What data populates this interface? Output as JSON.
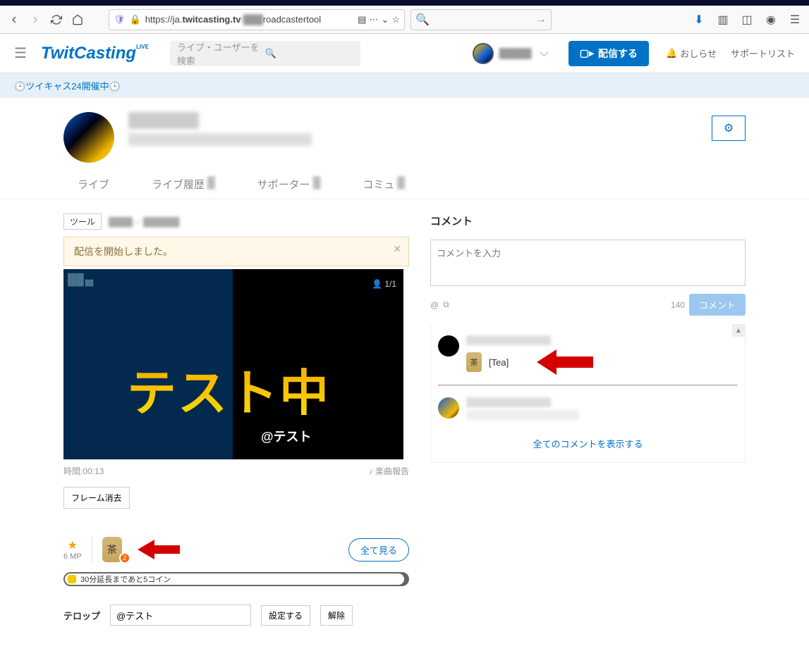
{
  "browser": {
    "url_prefix": "https://ja.",
    "url_domain": "twitcasting.tv",
    "url_suffix": "roadcastertool",
    "url_hidden": "/███"
  },
  "header": {
    "logo": "TwitCasting",
    "logo_sup": "LIVE",
    "search_placeholder": "ライブ・ユーザーを検索",
    "username": "█████",
    "broadcast_label": "配信する",
    "notif_label": "おしらせ",
    "support_link": "サポートリスト"
  },
  "announce": {
    "text": "ツイキャス24開催中",
    "emoji": "🕒"
  },
  "tabs": [
    {
      "label": "ライブ"
    },
    {
      "label": "ライブ履歴"
    },
    {
      "label": "サポーター"
    },
    {
      "label": "コミュ"
    }
  ],
  "tool": {
    "label": "ツール"
  },
  "alert": {
    "text": "配信を開始しました。"
  },
  "player": {
    "viewer_count": "1/1",
    "overlay_text": "テスト中",
    "telop_text": "@テスト",
    "time_label": "時間:00:13",
    "music_label": "楽曲報告"
  },
  "controls": {
    "frame_clear": "フレーム消去",
    "mp_value": "6 MP",
    "gift_badge": "2",
    "view_all": "全て見る",
    "progress_text": "30分延長まであと5コイン",
    "telop_label": "テロップ",
    "telop_input": "@テスト",
    "set_btn": "設定する",
    "clear_btn": "解除",
    "tea_char": "茶"
  },
  "comments": {
    "heading": "コメント",
    "placeholder": "コメントを入力",
    "count": "140",
    "send": "コメント",
    "at": "@",
    "gift_text": "[Tea]",
    "tea_char": "茶",
    "show_all": "全てのコメントを表示する"
  }
}
